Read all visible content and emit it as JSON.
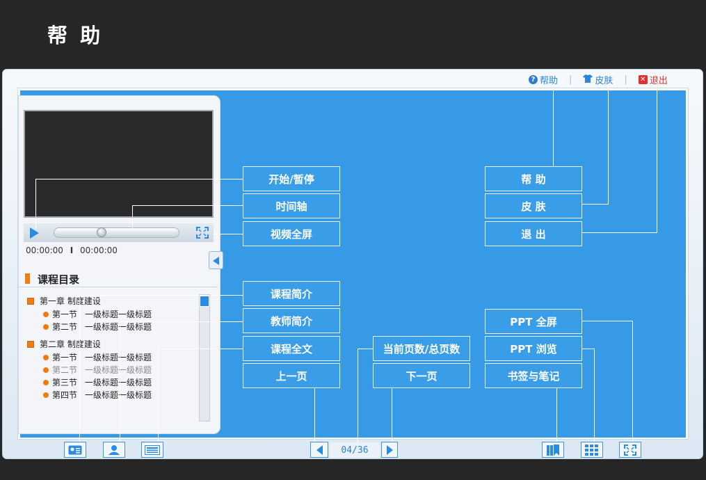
{
  "page": {
    "title": "帮 助"
  },
  "topbar": {
    "help": {
      "label": "帮助",
      "glyph": "?"
    },
    "skin": {
      "label": "皮肤",
      "glyph": "👕"
    },
    "exit": {
      "label": "退出",
      "glyph": "✕"
    }
  },
  "player": {
    "time_current": "00:00:00",
    "time_sep": "I",
    "time_total": "00:00:00",
    "progress": 0.37
  },
  "catalog": {
    "title": "课程目录",
    "chapters": [
      {
        "label": "第一章   制度建设",
        "sections": [
          {
            "num": "第一节",
            "text": "一级标题一级标题",
            "dim": false
          },
          {
            "num": "第二节",
            "text": "一级标题一级标题",
            "dim": false
          }
        ]
      },
      {
        "label": "第二章   制度建设",
        "sections": [
          {
            "num": "第一节",
            "text": "一级标题一级标题",
            "dim": false
          },
          {
            "num": "第二节",
            "text": "一级标题一级标题",
            "dim": true
          },
          {
            "num": "第三节",
            "text": "一级标题一级标题",
            "dim": false
          },
          {
            "num": "第四节",
            "text": "一级标题一级标题",
            "dim": false
          }
        ]
      }
    ]
  },
  "callouts": {
    "play_pause": "开始/暂停",
    "timeline": "时间轴",
    "video_fullscreen": "视频全屏",
    "course_intro": "课程简介",
    "teacher_intro": "教师简介",
    "course_text": "课程全文",
    "prev_page": "上一页",
    "page_count": "当前页数/总页数",
    "next_page": "下一页",
    "help": "帮    助",
    "skin": "皮    肤",
    "exit": "退    出",
    "ppt_fullscreen": "PPT  全屏",
    "ppt_browse": "PPT  浏览",
    "bookmark_notes": "书签与笔记"
  },
  "bottombar": {
    "page_indicator": "04/36"
  },
  "colors": {
    "accent": "#2b8be0",
    "canvas": "#379ae6",
    "orange": "#f07c16",
    "exit_red": "#e23030"
  }
}
